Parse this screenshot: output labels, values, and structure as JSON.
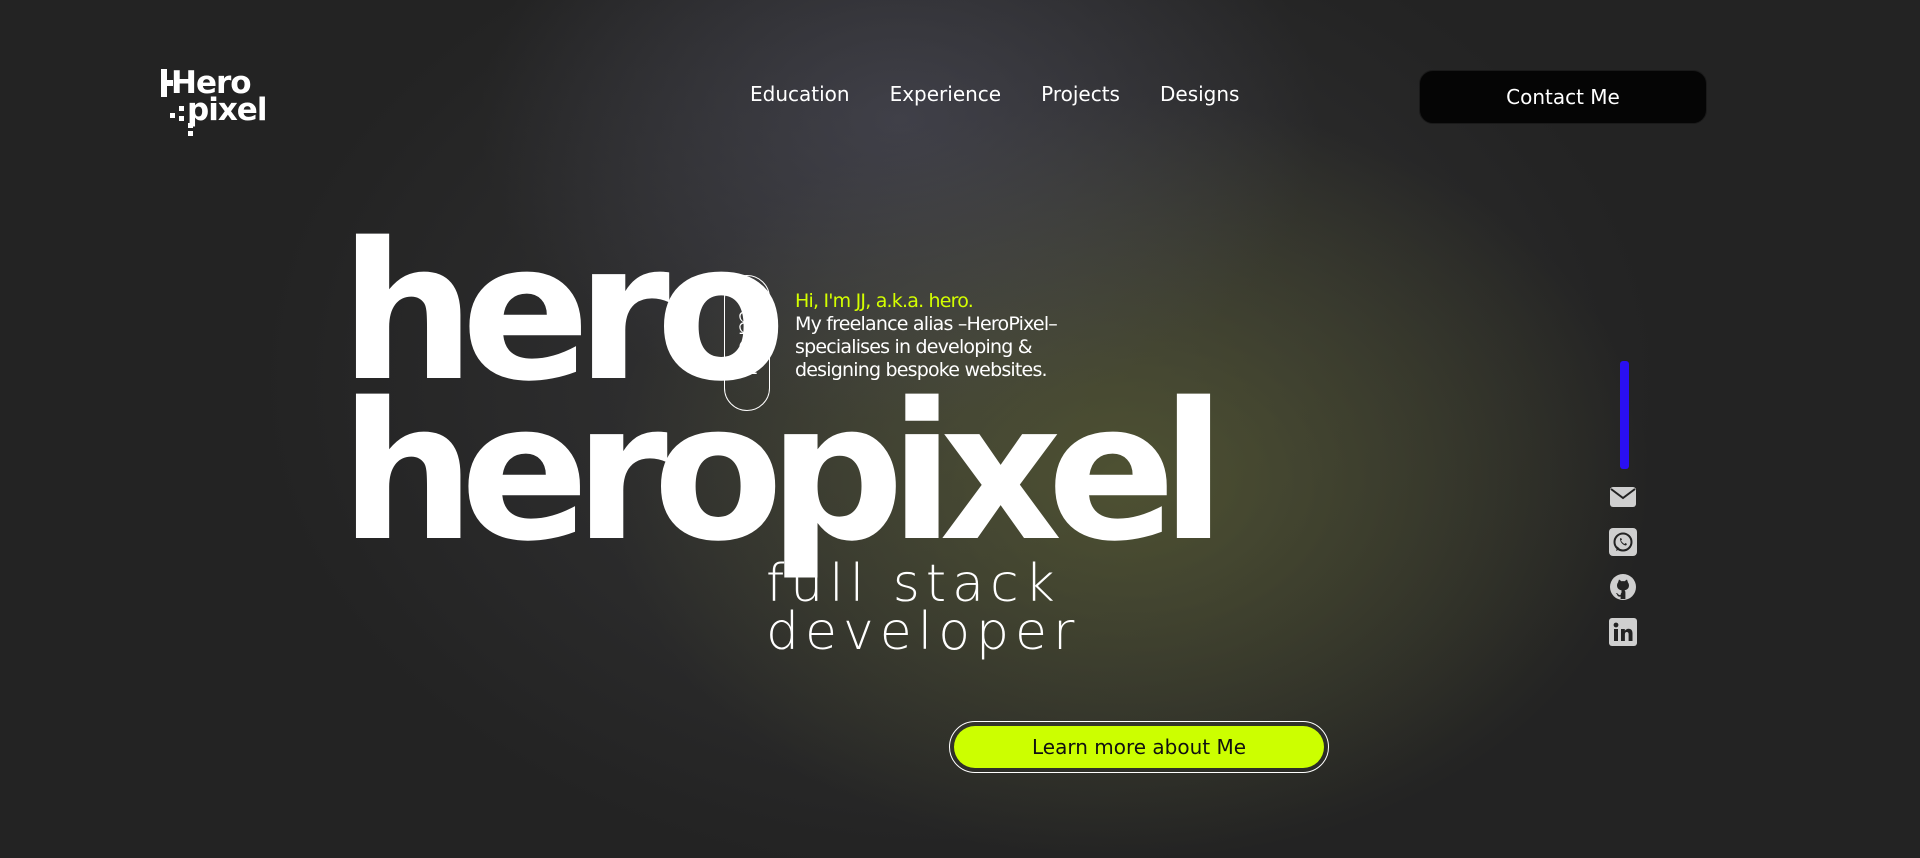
{
  "logo": {
    "line1": "Hero",
    "line2": "pixel"
  },
  "nav": {
    "items": [
      {
        "label": "Education"
      },
      {
        "label": "Experience"
      },
      {
        "label": "Projects"
      },
      {
        "label": "Designs"
      }
    ],
    "contact_label": "Contact Me"
  },
  "hero": {
    "word1": "hero",
    "word2": "heropixel",
    "from_label": "from",
    "greeting": "Hi, I'm JJ, a.k.a. hero.",
    "description": "My freelance alias –HeroPixel– specialises in developing & designing bespoke websites.",
    "role_line1": "full stack",
    "role_line2": "developer",
    "cta_label": "Learn more about Me"
  },
  "social": {
    "icons": [
      "email-icon",
      "whatsapp-icon",
      "github-icon",
      "linkedin-icon"
    ]
  },
  "colors": {
    "background": "#232323",
    "accent_lime": "#ccff00",
    "accent_blue": "#2a0ff2",
    "contact_button": "#050505",
    "icon_gray": "#cfcfcf"
  }
}
